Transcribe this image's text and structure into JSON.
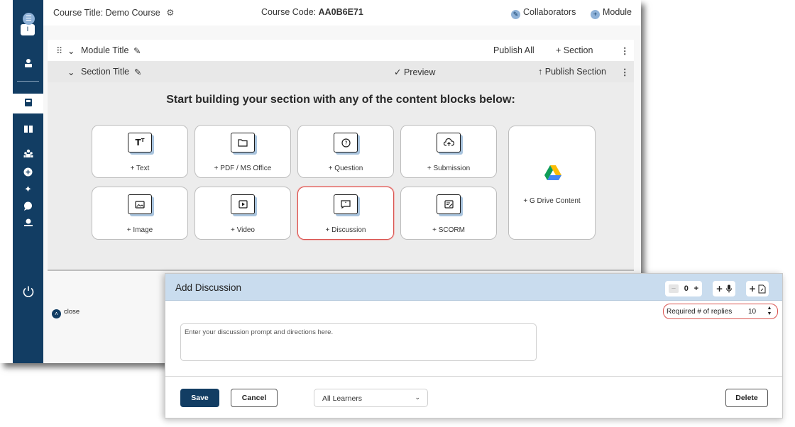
{
  "header": {
    "course_title": "Course Title: Demo Course",
    "course_code_label": "Course Code: ",
    "course_code": "AA0B6E71",
    "collaborators": "Collaborators",
    "module": "Module"
  },
  "sidebar": {
    "top_badge": "I",
    "icons": [
      "user-icon",
      "book-icon",
      "library-icon",
      "group-icon",
      "add-icon",
      "sparkle-icon",
      "chat-icon",
      "award-icon",
      "power-icon"
    ]
  },
  "module_row": {
    "title": "Module Title",
    "publish_all": "Publish All",
    "add_section": "+ Section"
  },
  "section_row": {
    "title": "Section Title",
    "preview": "Preview",
    "publish_section": "Publish Section"
  },
  "builder": {
    "heading": "Start building your section with any of the content blocks below:",
    "blocks": [
      {
        "label": "+ Text",
        "icon": "text-icon"
      },
      {
        "label": "+ PDF / MS Office",
        "icon": "folder-icon"
      },
      {
        "label": "+ Question",
        "icon": "question-icon"
      },
      {
        "label": "+ Submission",
        "icon": "upload-cloud-icon"
      },
      {
        "label": "+ Image",
        "icon": "image-icon"
      },
      {
        "label": "+ Video",
        "icon": "video-icon"
      },
      {
        "label": "+ Discussion",
        "icon": "discussion-icon"
      },
      {
        "label": "+ SCORM",
        "icon": "scorm-icon"
      }
    ],
    "gdrive_label": "+ G Drive Content",
    "close": "close"
  },
  "dialog": {
    "title": "Add Discussion",
    "counter_value": "0",
    "minus": "−",
    "plus": "+",
    "required_label": "Required # of replies",
    "required_value": "10",
    "prompt_placeholder": "Enter your discussion prompt and directions here.",
    "save": "Save",
    "cancel": "Cancel",
    "audience": "All Learners",
    "delete": "Delete"
  },
  "colors": {
    "sidebar": "#123d63",
    "dialog_header": "#c9dcee",
    "highlight": "#d9534f",
    "primary_button": "#123d63"
  }
}
